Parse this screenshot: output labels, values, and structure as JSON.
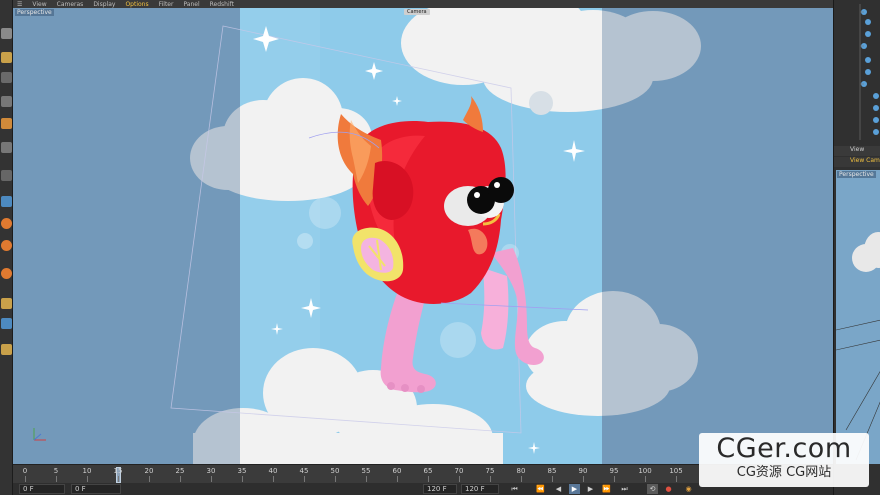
{
  "viewport": {
    "menu": [
      "View",
      "Cameras",
      "Display",
      "Options",
      "Filter",
      "Panel",
      "Redshift"
    ],
    "active_menu": "Options",
    "label": "Perspective",
    "camera_label": "Camera"
  },
  "right_panel": {
    "header": "View",
    "menu": [
      "View",
      "Cam"
    ],
    "viewport_label": "Perspective"
  },
  "timeline": {
    "ticks": [
      0,
      5,
      10,
      15,
      20,
      25,
      30,
      35,
      40,
      45,
      50,
      55,
      60,
      65,
      70,
      75,
      80,
      85,
      90,
      95,
      100,
      105
    ],
    "current_frame": 15
  },
  "transport": {
    "start": "0 F",
    "current": "0 F",
    "end": "120 F",
    "end_field": "120 F"
  },
  "watermark": {
    "main": "CGer.com",
    "sub": "CG资源 CG网站"
  },
  "colors": {
    "sky": "#8ecbea",
    "bg_dim": "#7aa6c8",
    "cloud": "#f2f2f2",
    "monster_red": "#e8192c",
    "horn_orange": "#f07a3c",
    "leg_pink": "#f2a0d0",
    "wing_yellow": "#f2e36a",
    "accent": "#f0c040"
  }
}
